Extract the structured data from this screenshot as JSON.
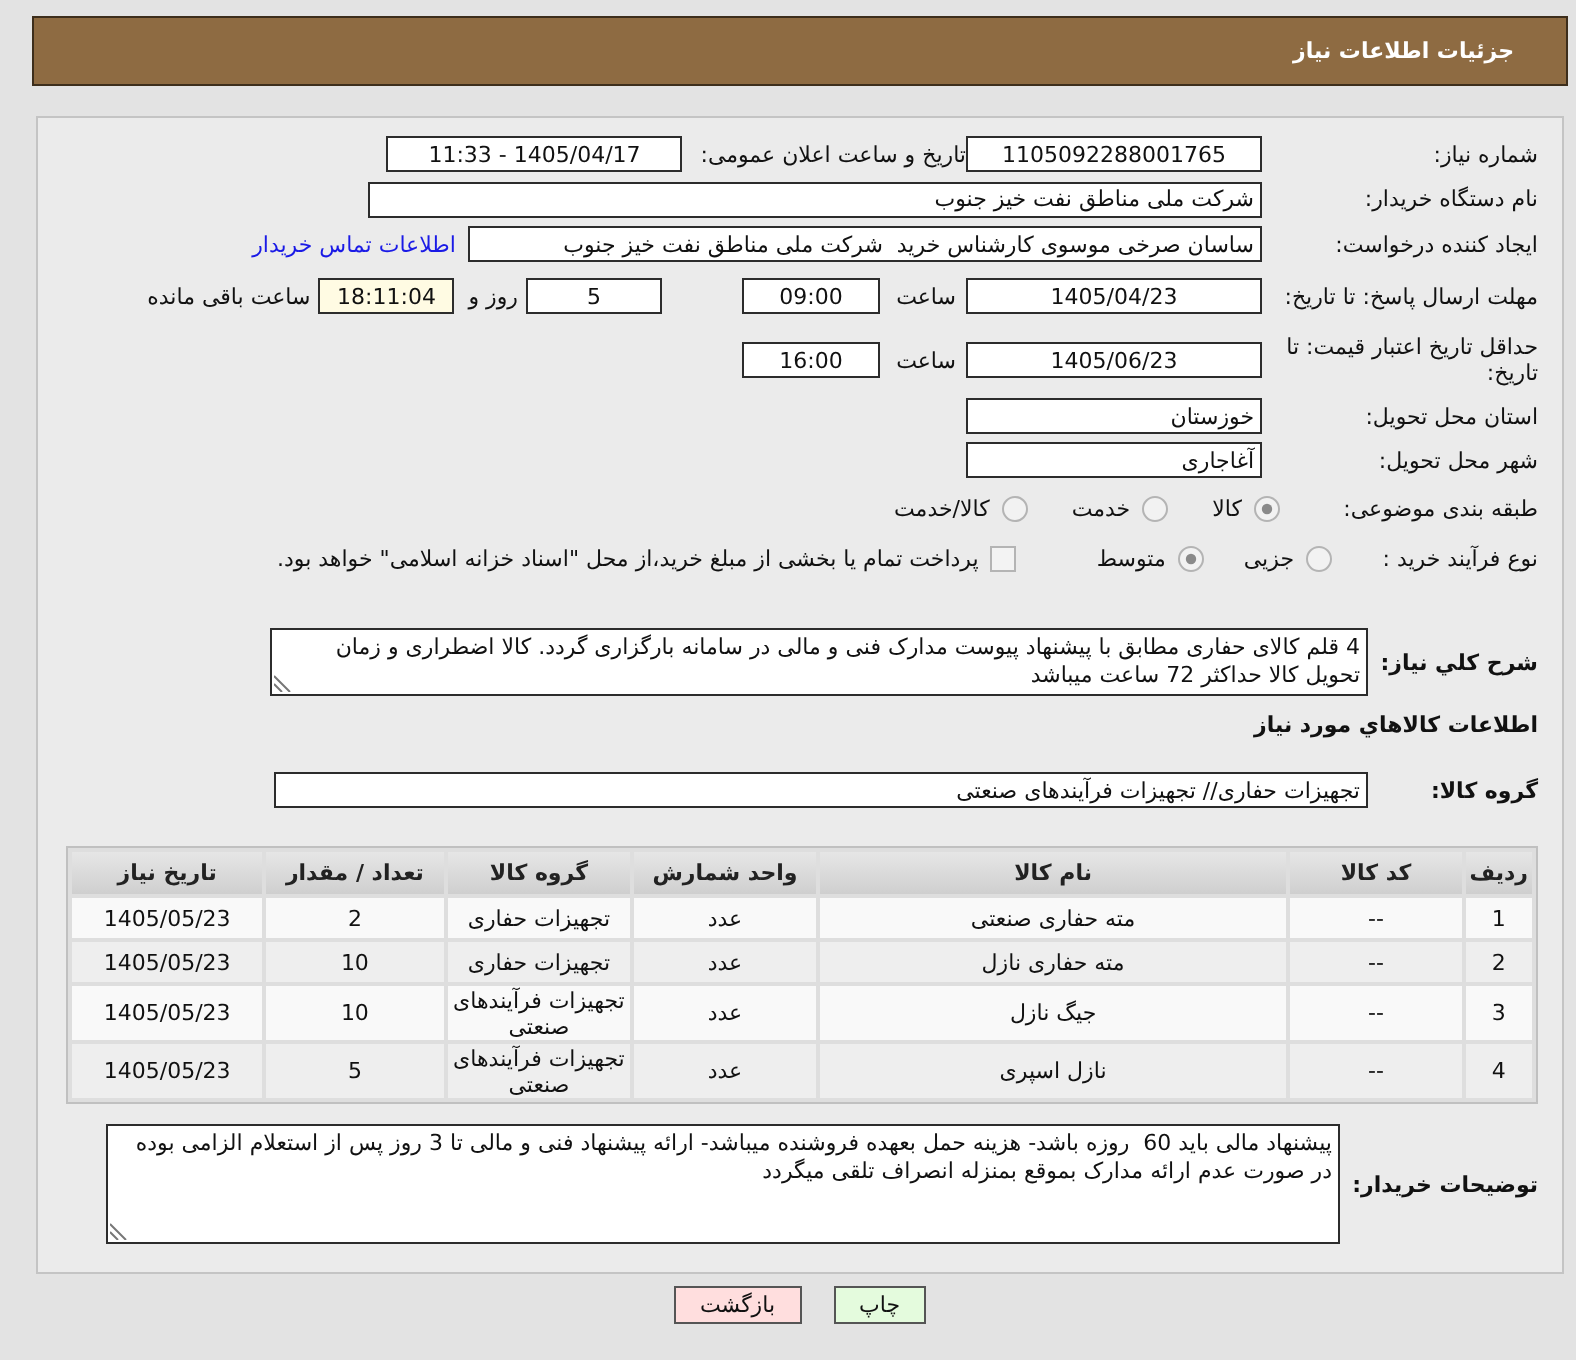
{
  "header": {
    "title": "جزئیات اطلاعات نیاز"
  },
  "need_info": {
    "need_number": {
      "label": "شماره نیاز:",
      "value": "1105092288001765"
    },
    "announce_datetime": {
      "label": "تاریخ و ساعت اعلان عمومی:",
      "value": "1405/04/17 - 11:33"
    },
    "buyer_org": {
      "label": "نام دستگاه خریدار:",
      "value": "شرکت ملی مناطق نفت خیز جنوب"
    },
    "requester": {
      "label": "ایجاد کننده درخواست:",
      "value": "ساسان صرخی موسوی کارشناس خرید  شرکت ملی مناطق نفت خیز جنوب",
      "link": "اطلاعات تماس خریدار"
    },
    "reply_deadline": {
      "label": "مهلت ارسال پاسخ: تا تاریخ:",
      "date": "1405/04/23",
      "time_label": "ساعت",
      "time": "09:00",
      "days": "5",
      "days_label": "روز و",
      "remaining": "18:11:04",
      "remaining_label": "ساعت باقی مانده"
    },
    "price_validity": {
      "label": "حداقل تاریخ اعتبار قیمت: تا تاریخ:",
      "date": "1405/06/23",
      "time_label": "ساعت",
      "time": "16:00"
    },
    "province": {
      "label": "استان محل تحویل:",
      "value": "خوزستان"
    },
    "city": {
      "label": "شهر محل تحویل:",
      "value": "آغاجاری"
    },
    "category": {
      "label": "طبقه بندی موضوعی:",
      "options": [
        {
          "label": "کالا",
          "selected": true
        },
        {
          "label": "خدمت",
          "selected": false
        },
        {
          "label": "کالا/خدمت",
          "selected": false
        }
      ]
    },
    "process_type": {
      "label": "نوع فرآیند خرید :",
      "options": [
        {
          "label": "جزیی",
          "selected": false
        },
        {
          "label": "متوسط",
          "selected": true
        }
      ],
      "treasury": {
        "label": "پرداخت تمام یا بخشی از مبلغ خرید،از محل \"اسناد خزانه اسلامی\" خواهد بود.",
        "checked": false
      }
    },
    "description": {
      "label": "شرح کلي نیاز:",
      "value": "4 قلم کالای حفاری مطابق با پیشنهاد پیوست مدارک فنی و مالی در سامانه بارگزاری گردد. کالا اضطراری و زمان تحویل کالا حداکثر 72 ساعت میباشد"
    }
  },
  "goods": {
    "title": "اطلاعات کالاهاي مورد نیاز",
    "group": {
      "label": "گروه کالا:",
      "value": "تجهیزات حفاری// تجهیزات فرآیندهای صنعتی"
    },
    "table": {
      "columns": [
        "ردیف",
        "کد کالا",
        "نام کالا",
        "واحد شمارش",
        "گروه کالا",
        "تعداد / مقدار",
        "تاریخ نیاز"
      ],
      "rows": [
        [
          "1",
          "--",
          "مته حفاری صنعتی",
          "عدد",
          "تجهیزات حفاری",
          "2",
          "1405/05/23"
        ],
        [
          "2",
          "--",
          "مته حفاری نازل",
          "عدد",
          "تجهیزات حفاری",
          "10",
          "1405/05/23"
        ],
        [
          "3",
          "--",
          "جیگ نازل",
          "عدد",
          "تجهیزات فرآیندهای صنعتی",
          "10",
          "1405/05/23"
        ],
        [
          "4",
          "--",
          "نازل اسپری",
          "عدد",
          "تجهیزات فرآیندهای صنعتی",
          "5",
          "1405/05/23"
        ]
      ]
    }
  },
  "buyer_notes": {
    "label": "توضیحات خریدار:",
    "value": "پیشنهاد مالی باید 60  روزه باشد- هزینه حمل بعهده فروشنده میباشد- ارائه پیشنهاد فنی و مالی تا 3 روز پس از استعلام الزامی بوده در صورت عدم ارائه مدارک بموقع بمنزله انصراف تلقی میگردد"
  },
  "buttons": [
    {
      "label": "چاپ",
      "kind": "print"
    },
    {
      "label": "بازگشت",
      "kind": "back"
    }
  ]
}
